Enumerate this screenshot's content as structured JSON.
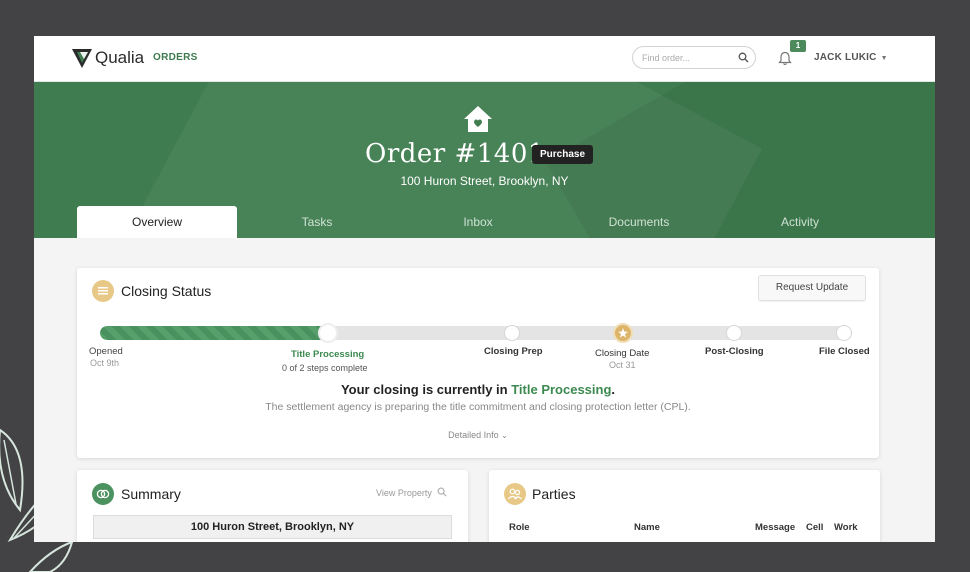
{
  "app": {
    "brand": "Qualia",
    "nav_orders": "ORDERS"
  },
  "search": {
    "placeholder": "Find order..."
  },
  "notifications": {
    "count": "1"
  },
  "user": {
    "name": "JACK LUKIC"
  },
  "order": {
    "title": "Order #1401",
    "type_badge": "Purchase",
    "address": "100 Huron Street, Brooklyn, NY"
  },
  "tabs": [
    {
      "label": "Overview",
      "active": true
    },
    {
      "label": "Tasks"
    },
    {
      "label": "Inbox"
    },
    {
      "label": "Documents"
    },
    {
      "label": "Activity"
    }
  ],
  "closing_status": {
    "title": "Closing Status",
    "request_update_label": "Request Update",
    "progress_fraction": 0.3,
    "steps": [
      {
        "label": "Opened",
        "sub": "Oct 9th"
      },
      {
        "label": "Title Processing",
        "sub": "0 of 2 steps complete"
      },
      {
        "label": "Closing Prep"
      },
      {
        "label": "Closing Date",
        "sub": "Oct 31"
      },
      {
        "label": "Post-Closing"
      },
      {
        "label": "File Closed"
      }
    ],
    "message_prefix": "Your closing is currently in ",
    "message_highlight": "Title Processing",
    "message_suffix": ".",
    "message_sub": "The settlement agency is preparing the title commitment and closing protection letter (CPL).",
    "detailed_info": "Detailed Info"
  },
  "summary": {
    "title": "Summary",
    "view_property": "View Property",
    "address": "100 Huron Street, Brooklyn, NY"
  },
  "parties": {
    "title": "Parties",
    "columns": [
      "Role",
      "Name",
      "Message",
      "Cell",
      "Work"
    ]
  },
  "colors": {
    "accent_green": "#3f7c4f",
    "progress_green": "#58a06b",
    "gold": "#dcb46a",
    "background": "#434346"
  }
}
